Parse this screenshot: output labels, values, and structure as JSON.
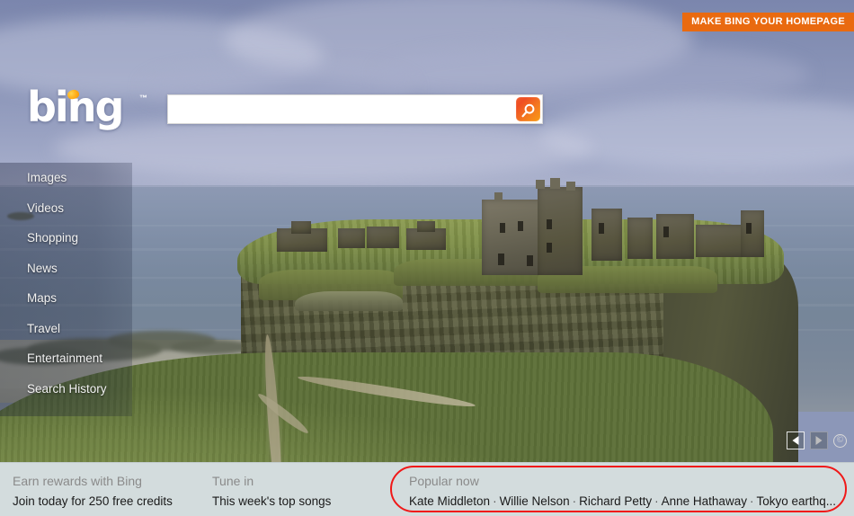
{
  "brand": {
    "logo_text": "bing",
    "trademark": "™",
    "accent_orange": "#f09000",
    "search_button_orange": "#f15a29"
  },
  "header": {
    "homepage_button": "MAKE BING YOUR HOMEPAGE"
  },
  "search": {
    "value": "",
    "placeholder": "",
    "button_icon": "magnifier-icon"
  },
  "sidebar": {
    "items": [
      {
        "label": "Images"
      },
      {
        "label": "Videos"
      },
      {
        "label": "Shopping"
      },
      {
        "label": "News"
      },
      {
        "label": "Maps"
      },
      {
        "label": "Travel"
      },
      {
        "label": "Entertainment"
      },
      {
        "label": "Search History"
      }
    ]
  },
  "image_controls": {
    "prev_icon": "triangle-left-icon",
    "next_icon": "triangle-right-icon",
    "copyright_icon": "copyright-icon",
    "copyright_glyph": "©"
  },
  "background_image": {
    "description": "Dunnottar Castle ruins on a grassy sea cliff, Scotland",
    "sky_color": "#8b95b8",
    "sea_color": "#7b8a9f",
    "grass_color": "#6f8242",
    "rock_color": "#5b5d41"
  },
  "bottom_bar": {
    "background_color": "#d3dcdd",
    "columns": [
      {
        "title": "Earn rewards with Bing",
        "subtitle": "Join today for 250 free credits"
      },
      {
        "title": "Tune in",
        "subtitle": "This week's top songs"
      }
    ],
    "popular": {
      "title": "Popular now",
      "highlight_color": "#f01818",
      "separator": "·",
      "terms": [
        "Kate Middleton",
        "Willie Nelson",
        "Richard Petty",
        "Anne Hathaway",
        "Tokyo earthq..."
      ]
    }
  }
}
